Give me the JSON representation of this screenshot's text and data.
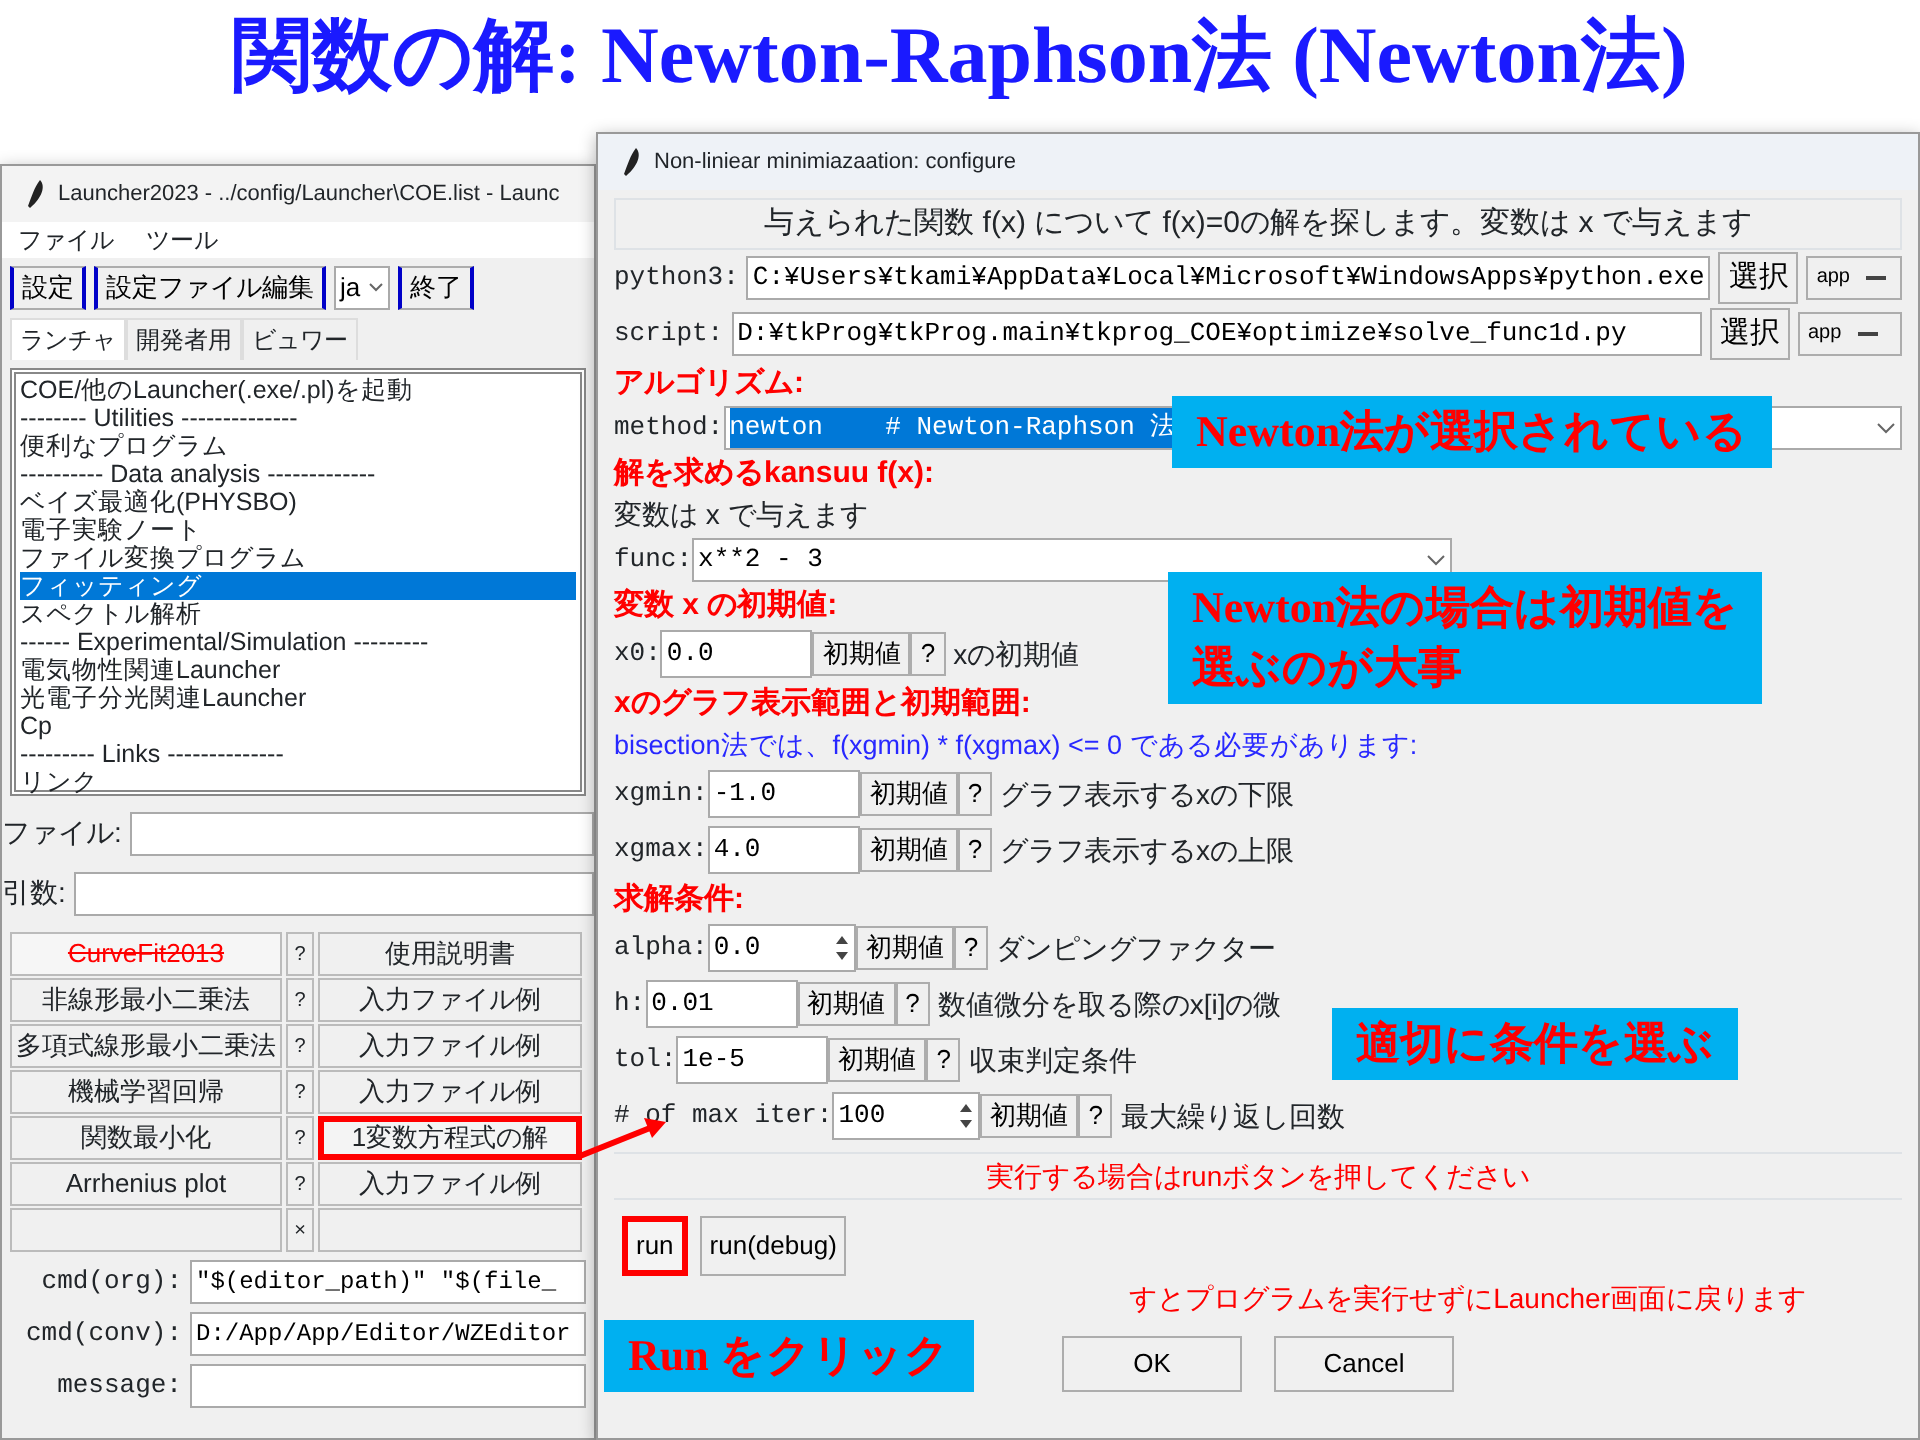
{
  "slide_title": "関数の解: Newton-Raphson法 (Newton法)",
  "launcher": {
    "title": "Launcher2023 - ../config/Launcher\\COE.list - Launc",
    "menu": [
      "ファイル",
      "ツール"
    ],
    "toolbar": [
      {
        "kind": "button",
        "label": "設定"
      },
      {
        "kind": "button",
        "label": "設定ファイル編集"
      },
      {
        "kind": "dropdown",
        "label": "ja"
      },
      {
        "kind": "button",
        "label": "終了"
      }
    ],
    "tabs": [
      {
        "label": "ランチャ",
        "selected": true
      },
      {
        "label": "開発者用",
        "selected": false
      },
      {
        "label": "ビュワー",
        "selected": false
      }
    ],
    "list": [
      {
        "text": "COE/他のLauncher(.exe/.pl)を起動",
        "selected": false
      },
      {
        "text": "-------- Utilities --------------",
        "selected": false
      },
      {
        "text": "便利なプログラム",
        "selected": false
      },
      {
        "text": "---------- Data analysis -------------",
        "selected": false
      },
      {
        "text": "ベイズ最適化(PHYSBO)",
        "selected": false
      },
      {
        "text": "電子実験ノート",
        "selected": false
      },
      {
        "text": "ファイル変換プログラム",
        "selected": false
      },
      {
        "text": "フィッティング",
        "selected": true
      },
      {
        "text": "スペクトル解析",
        "selected": false
      },
      {
        "text": "------ Experimental/Simulation ---------",
        "selected": false
      },
      {
        "text": "電気物性関連Launcher",
        "selected": false
      },
      {
        "text": "光電子分光関連Launcher",
        "selected": false
      },
      {
        "text": "Cp",
        "selected": false
      },
      {
        "text": "--------- Links --------------",
        "selected": false
      },
      {
        "text": "リンク",
        "selected": false
      }
    ],
    "fields": [
      {
        "label": "ファイル:"
      },
      {
        "label": "引数:"
      }
    ],
    "grid": [
      {
        "left": "CurveFit2013",
        "disabled": true,
        "help": "?",
        "right": "使用説明書",
        "highlighted": false
      },
      {
        "left": "非線形最小二乗法",
        "disabled": false,
        "help": "?",
        "right": "入力ファイル例",
        "highlighted": false
      },
      {
        "left": "多項式線形最小二乗法",
        "disabled": false,
        "help": "?",
        "right": "入力ファイル例",
        "highlighted": false
      },
      {
        "left": "機械学習回帰",
        "disabled": false,
        "help": "?",
        "right": "入力ファイル例",
        "highlighted": false
      },
      {
        "left": "関数最小化",
        "disabled": false,
        "help": "?",
        "right": "1変数方程式の解",
        "highlighted": true
      },
      {
        "left": "Arrhenius plot",
        "disabled": false,
        "help": "?",
        "right": "入力ファイル例",
        "highlighted": false
      },
      {
        "help": "×"
      }
    ],
    "cmds": [
      {
        "label": "cmd(org):",
        "value": "\"$(editor_path)\" \"$(file_"
      },
      {
        "label": "cmd(conv):",
        "value": "D:/App/App/Editor/WZEditor"
      },
      {
        "label": "message:"
      }
    ]
  },
  "dialog": {
    "title": "Non-liniear minimiazaation: configure",
    "intro": "与えられた関数 f(x) について f(x)=0の解を探します。変数は x で与えます",
    "rows": [
      {
        "kind": "path",
        "label": "python3:",
        "value": "C:¥Users¥tkami¥AppData¥Local¥Microsoft¥WindowsApps¥python.exe",
        "button": "選択",
        "app": "app"
      },
      {
        "kind": "path",
        "label": "script:",
        "value": "D:¥tkProg¥tkProg.main¥tkprog_COE¥optimize¥solve_func1d.py",
        "button": "選択",
        "app": "app"
      },
      {
        "kind": "heading",
        "text": "アルゴリズム:"
      },
      {
        "kind": "select",
        "label": "method:",
        "value": "newton    # Newton-Raphson 法"
      },
      {
        "kind": "heading",
        "text": "解を求めるkansuu  f(x):"
      },
      {
        "kind": "text",
        "text": "変数は x で与えます"
      },
      {
        "kind": "combo",
        "label": "func:",
        "value": "x**2 - 3"
      },
      {
        "kind": "heading",
        "text": "変数 x の初期値:"
      },
      {
        "kind": "param",
        "label": "x0:",
        "value": "0.0",
        "spin": false,
        "default": "初期値",
        "help": "?",
        "desc": "xの初期値"
      },
      {
        "kind": "heading",
        "text": "xのグラフ表示範囲と初期範囲:"
      },
      {
        "kind": "note",
        "text": "bisection法では、f(xgmin) * f(xgmax) <= 0 である必要があります:"
      },
      {
        "kind": "param",
        "label": "xgmin:",
        "value": "-1.0",
        "spin": false,
        "default": "初期値",
        "help": "?",
        "desc": "グラフ表示するxの下限"
      },
      {
        "kind": "param",
        "label": "xgmax:",
        "value": "4.0",
        "spin": false,
        "default": "初期値",
        "help": "?",
        "desc": "グラフ表示するxの上限"
      },
      {
        "kind": "heading",
        "text": "求解条件:"
      },
      {
        "kind": "param",
        "label": "alpha:",
        "value": "0.0",
        "spin": true,
        "default": "初期値",
        "help": "?",
        "desc": "ダンピングファクター"
      },
      {
        "kind": "param",
        "label": "h:",
        "value": "0.01",
        "spin": false,
        "default": "初期値",
        "help": "?",
        "desc": "数値微分を取る際のx[i]の微"
      },
      {
        "kind": "param",
        "label": "tol:",
        "value": "1e-5",
        "spin": false,
        "default": "初期値",
        "help": "?",
        "desc": "収束判定条件"
      },
      {
        "kind": "param",
        "label": "# of max iter:",
        "value": "100",
        "spin": true,
        "default": "初期値",
        "help": "?",
        "desc": "最大繰り返し回数"
      }
    ],
    "run_hint": "実行する場合はrunボタンを押してください",
    "run_buttons": [
      {
        "label": "run",
        "highlighted": true
      },
      {
        "label": "run(debug)",
        "highlighted": false
      }
    ],
    "ok_hint": "すとプログラムを実行せずにLauncher画面に戻ります",
    "buttons": [
      "OK",
      "Cancel"
    ]
  },
  "callouts": [
    {
      "lines": [
        "Newton法が選択されている"
      ]
    },
    {
      "lines": [
        "Newton法の場合は初期値を",
        "選ぶのが大事"
      ]
    },
    {
      "lines": [
        "適切に条件を選ぶ"
      ]
    },
    {
      "lines": [
        "Run をクリック"
      ]
    }
  ]
}
